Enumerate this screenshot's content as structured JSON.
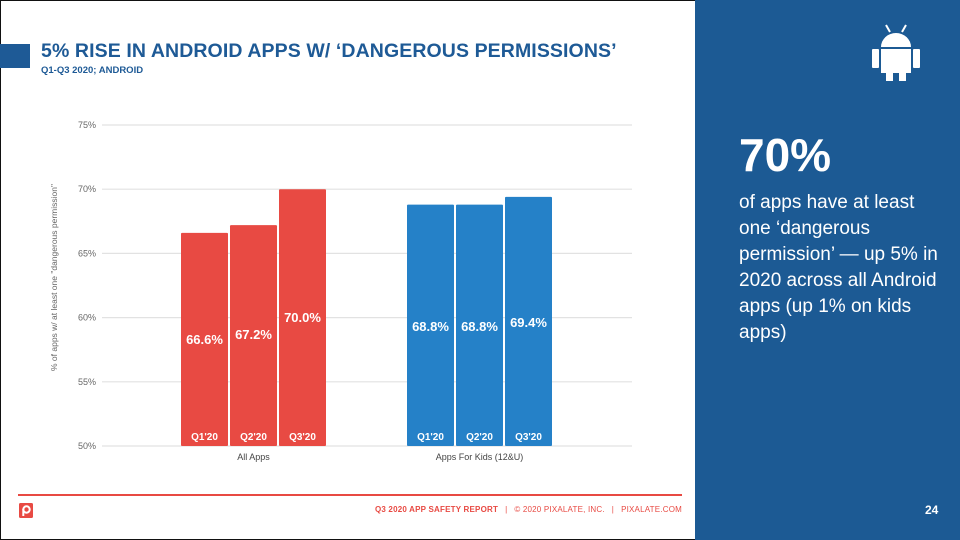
{
  "header": {
    "title": "5% RISE IN ANDROID APPS W/ ‘DANGEROUS PERMISSIONS’",
    "subtitle": "Q1-Q3 2020; ANDROID"
  },
  "side_panel": {
    "icon": "android-icon",
    "big_stat": "70%",
    "description": "of apps have at least one ‘dangerous permission’ — up 5% in 2020 across all Android apps (up 1% on kids apps)",
    "page_number": "24"
  },
  "footer": {
    "logo": "pixalate-logo-icon",
    "report": "Q3 2020 APP SAFETY REPORT",
    "separator": "|",
    "copyright": "© 2020 PIXALATE, INC.",
    "site": "PIXALATE.COM"
  },
  "colors": {
    "brand_blue": "#1E5A96",
    "panel_blue": "#1C5A94",
    "all_apps_red": "#E84A43",
    "kids_apps_blue": "#2581C8",
    "gridline": "#E2E2E2"
  },
  "chart_data": {
    "type": "bar",
    "title": "",
    "xlabel": "",
    "ylabel": "% of apps w/ at least one \"dangerous permission\"",
    "ylim": [
      50,
      75
    ],
    "yticks": [
      50,
      55,
      60,
      65,
      70,
      75
    ],
    "ytick_labels": [
      "50%",
      "55%",
      "60%",
      "65%",
      "70%",
      "75%"
    ],
    "grid": true,
    "groups": [
      {
        "name": "All Apps",
        "color": "#E84A43",
        "categories": [
          "Q1'20",
          "Q2'20",
          "Q3'20"
        ],
        "values": [
          66.6,
          67.2,
          70.0
        ],
        "labels": [
          "66.6%",
          "67.2%",
          "70.0%"
        ]
      },
      {
        "name": "Apps For Kids (12&U)",
        "color": "#2581C8",
        "categories": [
          "Q1'20",
          "Q2'20",
          "Q3'20"
        ],
        "values": [
          68.8,
          68.8,
          69.4
        ],
        "labels": [
          "68.8%",
          "68.8%",
          "69.4%"
        ]
      }
    ]
  }
}
